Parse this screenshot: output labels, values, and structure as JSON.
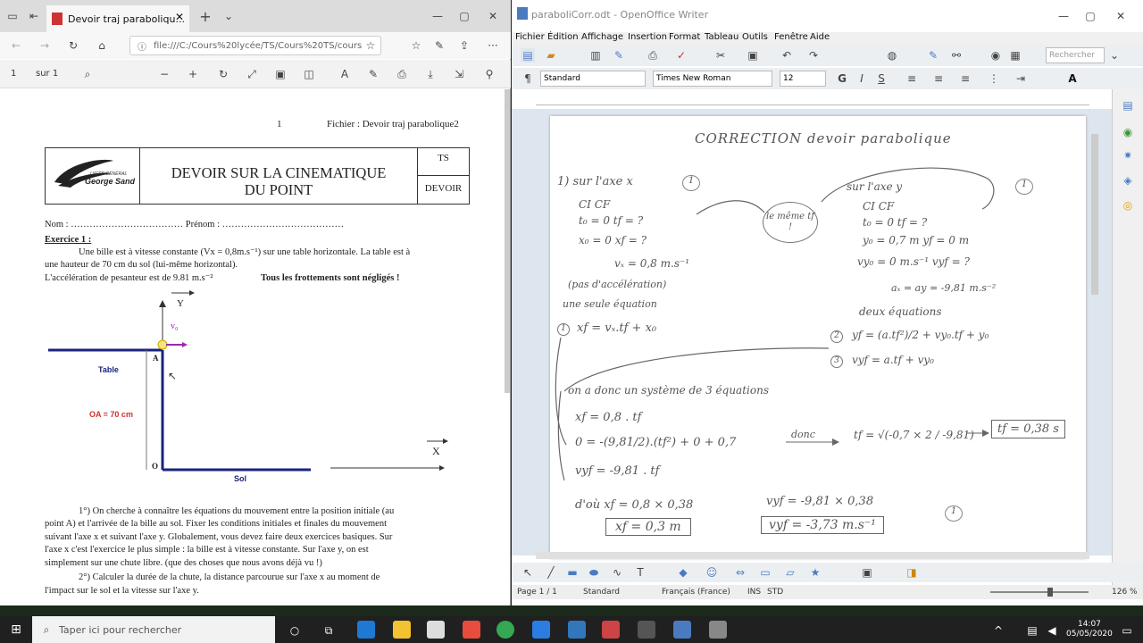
{
  "edge": {
    "tab_title": "Devoir traj paraboliqu...",
    "url": "file:///C:/Cours%20lycée/TS/Cours%20TS/cours",
    "page_number": "1",
    "page_total": "sur 1"
  },
  "pdf": {
    "page_header_num": "1",
    "page_header_file": "Fichier : Devoir traj parabolique2",
    "logo_text_small": "LYCÉE GÉNÉRAL",
    "logo_text": "George Sand",
    "title_line1": "DEVOIR  SUR  LA  CINEMATIQUE",
    "title_line2": "DU  POINT",
    "class_cell": "TS",
    "type_cell": "DEVOIR",
    "name_line": "Nom : ………………………………  Prénom : …………………………………",
    "exercise_title": "Exercice 1 :",
    "para1a": "Une bille est à vitesse constante (Vx = 0,8m.s⁻¹) sur une table horizontale. La table est à",
    "para1b": "une hauteur de 70 cm du sol (lui-même horizontal).",
    "para1c": "L'accélération de pesanteur est de 9.81 m.s⁻²",
    "para1d": "Tous les frottements sont négligés !",
    "fig_y": "Y",
    "fig_v": "v₀",
    "fig_A": "A",
    "fig_O": "O",
    "fig_table": "Table",
    "fig_oa": "OA = 70 cm",
    "fig_sol": "Sol",
    "fig_x": "X",
    "q1a": "1°) On cherche à connaître les équations du mouvement entre la position initiale (au",
    "q1b": "point A) et l'arrivée de la bille au sol. Fixer les conditions initiales et finales du mouvement",
    "q1c": "suivant l'axe x et suivant l'axe y. Globalement, vous devez faire deux exercices basiques. Sur",
    "q1d": "l'axe x c'est l'exercice le plus simple : la bille est à vitesse constante. Sur l'axe y, on est",
    "q1e": "simplement sur une chute libre. (que des choses que nous avons déjà vu !)",
    "q2a": "2°) Calculer la durée de la chute, la distance parcourue sur l'axe x au moment de",
    "q2b": "l'impact sur le sol et la vitesse sur l'axe y."
  },
  "writer": {
    "title": "paraboliCorr.odt - OpenOffice Writer",
    "menus": [
      "Fichier",
      "Édition",
      "Affichage",
      "Insertion",
      "Format",
      "Tableau",
      "Outils",
      "Fenêtre",
      "Aide"
    ],
    "search_placeholder": "Rechercher",
    "para_style": "Standard",
    "font_name": "Times New Roman",
    "font_size": "12",
    "status_page": "Page 1 / 1",
    "status_style": "Standard",
    "status_lang": "Français (France)",
    "status_ins": "INS",
    "status_std": "STD",
    "zoom": "126 %"
  },
  "handwriting": {
    "title": "CORRECTION  devoir parabolique",
    "sur_x": "1)  sur l'axe x",
    "sur_y": "sur l'axe y",
    "bubble": "le même tf !",
    "ci_l": "CI        CF",
    "t0_l": "t₀ = 0    tf = ?",
    "x0_l": "x₀ = 0    xf = ?",
    "vx": "vₓ = 0,8 m.s⁻¹",
    "pas_accel": "(pas d'accélération)",
    "une_eq": "une seule équation",
    "ci_r": "CI        CF",
    "t0_r": "t₀ = 0    tf = ?",
    "y0_r": "y₀ = 0,7 m   yf = 0 m",
    "vy_r": "vy₀ = 0 m.s⁻¹   vyf = ?",
    "a_r": "aₓ = ay = -9,81 m.s⁻²",
    "deux_eq": "deux équations",
    "eq1": "xf = vₓ.tf + x₀",
    "eq2": "yf = (a.tf²)/2 + vy₀.tf + y₀",
    "eq3": "vyf = a.tf + vy₀",
    "systeme": "on a donc un système de 3 équations",
    "s1": "xf = 0,8 . tf",
    "s2": "0 = -(9,81/2).(tf²) + 0 + 0,7",
    "s3": "vyf = -9,81 . tf",
    "donc": "donc",
    "tf_calc": "tf = √(-0,7 × 2 / -9,81)",
    "tf_res": "tf = 0,38 s",
    "xf_calc": "d'où  xf = 0,8 × 0,38",
    "xf_res": "xf = 0,3 m",
    "vyf_calc": "vyf = -9,81 × 0,38",
    "vyf_res": "vyf = -3,73 m.s⁻¹",
    "n1": "1",
    "n2": "1",
    "n3": "1",
    "c1": "1",
    "c2": "2",
    "c3": "3"
  },
  "taskbar": {
    "search_placeholder": "Taper ici pour rechercher",
    "time": "14:07",
    "date": "05/05/2020"
  }
}
